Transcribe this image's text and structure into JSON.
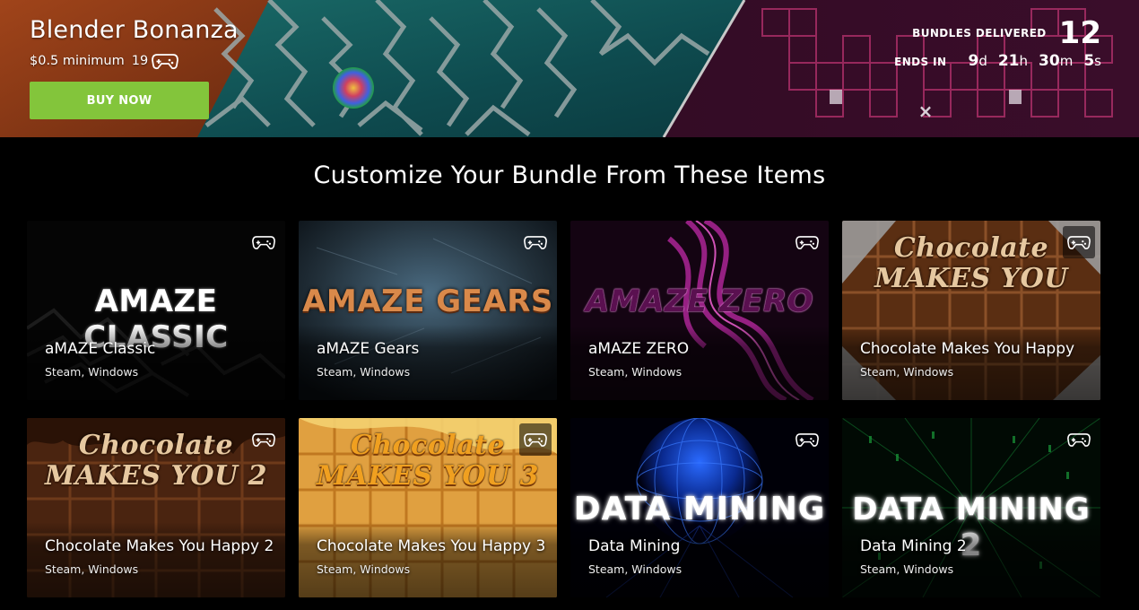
{
  "colors": {
    "buy_button": "#83c53b",
    "page_background": "#000000",
    "text": "#ffffff"
  },
  "hero": {
    "title": "Blender Bonanza",
    "minimum": "$0.5 minimum",
    "item_count": "19",
    "item_count_icon": "gamepad-icon",
    "buy_label": "BUY NOW",
    "bundles_delivered_label": "BUNDLES DELIVERED",
    "bundles_delivered_value": "12",
    "ends_in_label": "ENDS IN",
    "countdown": [
      {
        "value": "9",
        "unit": "d"
      },
      {
        "value": "21",
        "unit": "h"
      },
      {
        "value": "30",
        "unit": "m"
      },
      {
        "value": "5",
        "unit": "s"
      }
    ]
  },
  "section": {
    "title": "Customize Your Bundle From These Items"
  },
  "items": [
    {
      "name": "aMAZE Classic",
      "platforms": "Steam, Windows",
      "logo": "AMAZE CLASSIC",
      "icon": "gamepad-icon"
    },
    {
      "name": "aMAZE Gears",
      "platforms": "Steam, Windows",
      "logo": "AMAZE GEARS",
      "icon": "gamepad-icon"
    },
    {
      "name": "aMAZE ZERO",
      "platforms": "Steam, Windows",
      "logo": "AMAZE ZERO",
      "icon": "gamepad-icon"
    },
    {
      "name": "Chocolate Makes You Happy",
      "platforms": "Steam, Windows",
      "logo": "Chocolate MAKES YOU",
      "icon": "gamepad-icon"
    },
    {
      "name": "Chocolate Makes You Happy 2",
      "platforms": "Steam, Windows",
      "logo": "Chocolate MAKES YOU 2",
      "icon": "gamepad-icon"
    },
    {
      "name": "Chocolate Makes You Happy 3",
      "platforms": "Steam, Windows",
      "logo": "Chocolate MAKES YOU 3",
      "icon": "gamepad-icon"
    },
    {
      "name": "Data Mining",
      "platforms": "Steam, Windows",
      "logo": "DATA MINING",
      "icon": "gamepad-icon"
    },
    {
      "name": "Data Mining 2",
      "platforms": "Steam, Windows",
      "logo": "DATA MINING 2",
      "icon": "gamepad-icon"
    }
  ]
}
